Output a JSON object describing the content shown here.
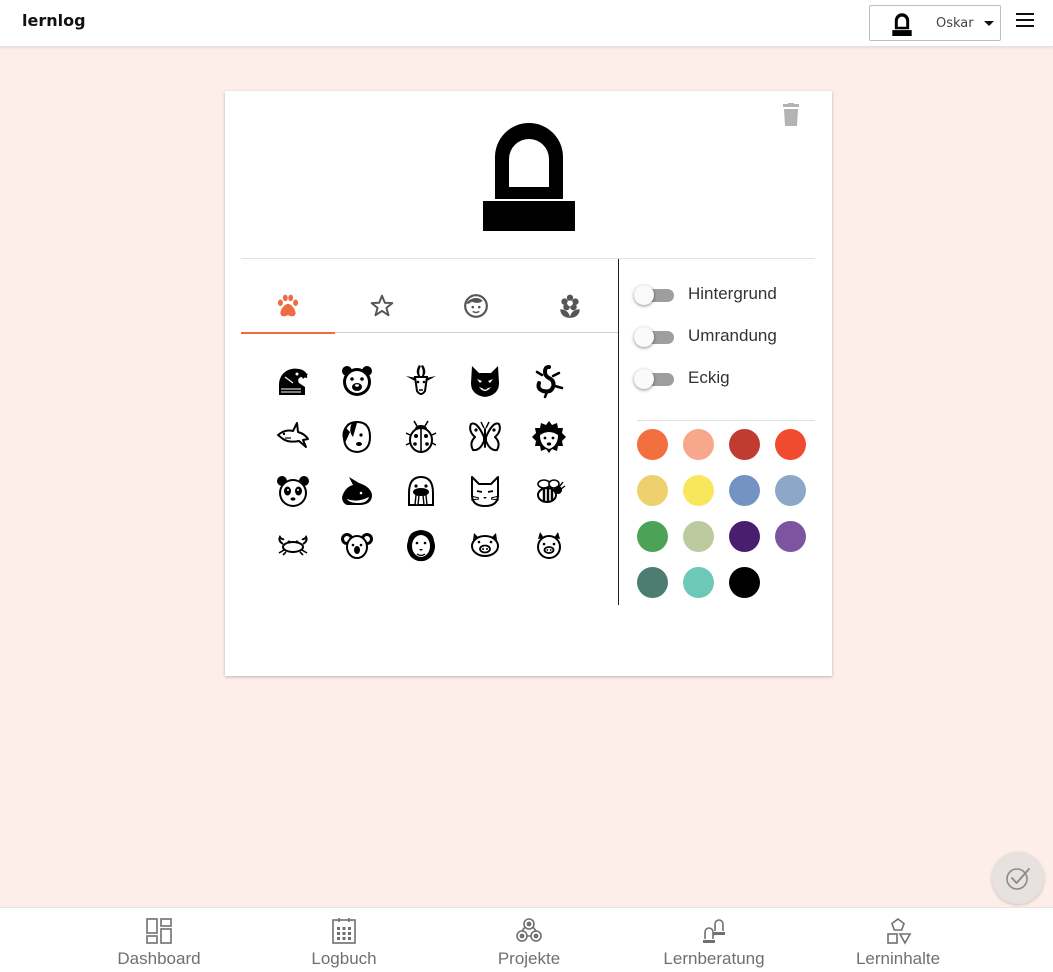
{
  "header": {
    "brand": "lernlog",
    "user_name": "Oskar"
  },
  "avatar_editor": {
    "category_tabs": [
      {
        "icon": "paw-icon",
        "active": true
      },
      {
        "icon": "star-icon",
        "active": false
      },
      {
        "icon": "face-icon",
        "active": false
      },
      {
        "icon": "flower-icon",
        "active": false
      }
    ],
    "animal_icons": [
      "eagle-icon",
      "bear-icon",
      "goat-icon",
      "wolf-icon",
      "lizard-icon",
      "shark-icon",
      "dog-icon",
      "ladybug-icon",
      "butterfly-icon",
      "hedgehog-icon",
      "panda-icon",
      "whale-icon",
      "walrus-icon",
      "cat-icon",
      "bee-icon",
      "crab-icon",
      "koala-icon",
      "lion-icon",
      "pig-icon",
      "piglet-icon"
    ],
    "options": [
      {
        "label": "Hintergrund",
        "on": false
      },
      {
        "label": "Umrandung",
        "on": false
      },
      {
        "label": "Eckig",
        "on": false
      }
    ],
    "colors": [
      "#f26f40",
      "#f7a88c",
      "#c03c32",
      "#f04b2e",
      "#eed16e",
      "#f8e65b",
      "#7393c2",
      "#8da7c9",
      "#4aa356",
      "#bccb9f",
      "#4a1e6e",
      "#7c54a0",
      "#4d7d71",
      "#6dc8b7",
      "#000000"
    ]
  },
  "bottom_nav": [
    {
      "label": "Dashboard",
      "icon": "dashboard-icon"
    },
    {
      "label": "Logbuch",
      "icon": "calendar-icon"
    },
    {
      "label": "Projekte",
      "icon": "projects-icon"
    },
    {
      "label": "Lernberatung",
      "icon": "counseling-icon"
    },
    {
      "label": "Lerninhalte",
      "icon": "shapes-icon"
    }
  ]
}
